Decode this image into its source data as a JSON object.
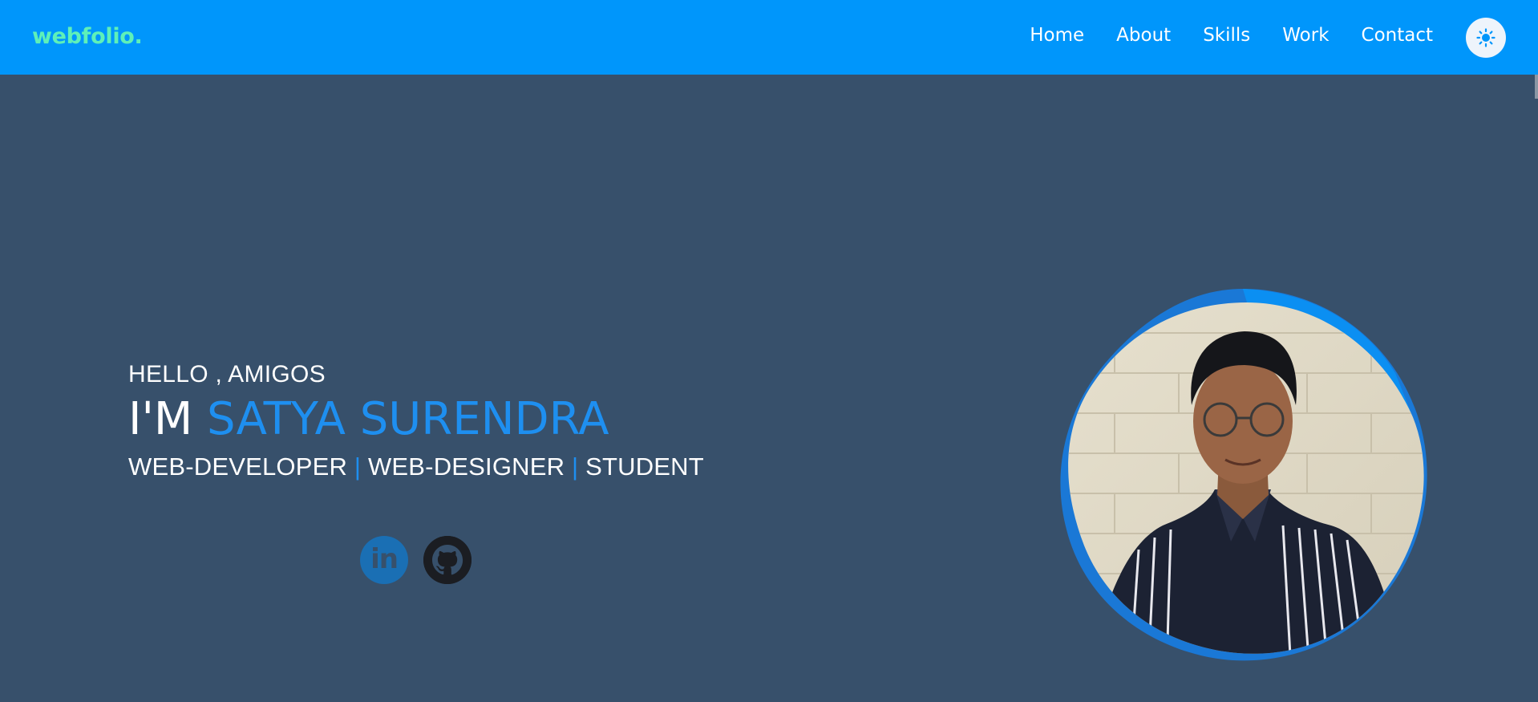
{
  "header": {
    "logo": "webfolio.",
    "nav": [
      "Home",
      "About",
      "Skills",
      "Work",
      "Contact"
    ],
    "theme_icon": "sun-icon"
  },
  "hero": {
    "greeting": "HELLO , AMIGOS",
    "im": "I'M ",
    "name": "SATYA SURENDRA",
    "roles": [
      "WEB-DEVELOPER",
      "WEB-DESIGNER",
      "STUDENT"
    ],
    "separator": " | ",
    "social": {
      "linkedin_text": "in",
      "linkedin_icon": "linkedin-icon",
      "github_icon": "github-icon"
    }
  },
  "colors": {
    "header_bg": "#0096fb",
    "page_bg": "#37506b",
    "accent": "#1e8ff0",
    "logo": "#5ef0b8"
  }
}
